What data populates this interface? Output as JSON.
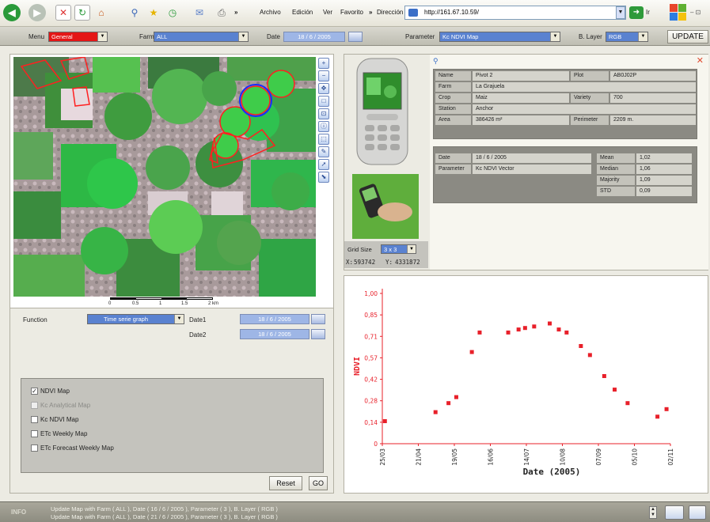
{
  "browser": {
    "menu": [
      "Archivo",
      "Edición",
      "Ver",
      "Favorito"
    ],
    "address_label": "Dirección",
    "url": "http://161.67.10.59/",
    "go_label": "Ir"
  },
  "header": {
    "menu_label": "Menu",
    "menu_value": "General",
    "farm_label": "Farm",
    "farm_value": "ALL",
    "date_label": "Date",
    "date_value": "18 / 6 / 2005",
    "parameter_label": "Parameter",
    "parameter_value": "Kc NDVI Map",
    "blayer_label": "B. Layer",
    "blayer_value": "RGB",
    "update_label": "UPDATE"
  },
  "map": {
    "scale_labels": [
      "0",
      "0.5",
      "1",
      "1.5",
      "2 km"
    ],
    "accent": "#ff2020",
    "highlight": "#1a2cff"
  },
  "function_panel": {
    "function_label": "Function",
    "function_value": "Time serie graph",
    "date1_label": "Date1",
    "date1_value": "18 / 6 / 2005",
    "date2_label": "Date2",
    "date2_value": "18 / 6 / 2005",
    "layers": [
      {
        "label": "NDVI Map",
        "checked": true,
        "enabled": true
      },
      {
        "label": "Kc Analytical Map",
        "checked": false,
        "enabled": false
      },
      {
        "label": "Kc NDVI Map",
        "checked": false,
        "enabled": true
      },
      {
        "label": "ETc Weekly Map",
        "checked": false,
        "enabled": true
      },
      {
        "label": "ETc Forecast Weekly Map",
        "checked": false,
        "enabled": true
      }
    ],
    "reset_label": "Reset",
    "go_label": "GO"
  },
  "device": {
    "grid_size_label": "Grid Size",
    "grid_size_value": "3 x 3",
    "x_label": "X:",
    "x_value": "593742",
    "y_label": "Y:",
    "y_value": "4331872"
  },
  "plot_info": {
    "name_label": "Name",
    "name_value": "Pivot 2",
    "plot_label": "Plot",
    "plot_value": "AB0J02P",
    "farm_label": "Farm",
    "farm_value": "La Grajuela",
    "crop_label": "Crop",
    "crop_value": "Maiz",
    "variety_label": "Variety",
    "variety_value": "700",
    "station_label": "Station",
    "station_value": "Anchor",
    "area_label": "Area",
    "area_value": "386426 m²",
    "perimeter_label": "Perimeter",
    "perimeter_value": "2209 m."
  },
  "stats": {
    "date_label": "Date",
    "date_value": "18 / 6 / 2005",
    "parameter_label": "Parameter",
    "parameter_value": "Kc NDVI Vector",
    "mean_label": "Mean",
    "mean_value": "1,02",
    "median_label": "Median",
    "median_value": "1,06",
    "majority_label": "Majority",
    "majority_value": "1,09",
    "std_label": "STD",
    "std_value": "0,09"
  },
  "chart_data": {
    "type": "scatter",
    "xlabel": "Date (2005)",
    "ylabel": "NDVI",
    "x_ticks": [
      "25/03",
      "21/04",
      "19/05",
      "16/06",
      "14/07",
      "10/08",
      "07/09",
      "05/10",
      "02/11"
    ],
    "y_ticks": [
      "0",
      "0,14",
      "0,28",
      "0,42",
      "0,57",
      "0,71",
      "0,85",
      "1,00"
    ],
    "ylim": [
      0,
      1
    ],
    "x_day_range": [
      84,
      306
    ],
    "marker_color": "#e8202a",
    "points": [
      {
        "day": 86,
        "ndvi": 0.15
      },
      {
        "day": 125,
        "ndvi": 0.21
      },
      {
        "day": 135,
        "ndvi": 0.27
      },
      {
        "day": 141,
        "ndvi": 0.31
      },
      {
        "day": 153,
        "ndvi": 0.61
      },
      {
        "day": 159,
        "ndvi": 0.74
      },
      {
        "day": 181,
        "ndvi": 0.74
      },
      {
        "day": 189,
        "ndvi": 0.76
      },
      {
        "day": 194,
        "ndvi": 0.77
      },
      {
        "day": 201,
        "ndvi": 0.78
      },
      {
        "day": 213,
        "ndvi": 0.8
      },
      {
        "day": 220,
        "ndvi": 0.76
      },
      {
        "day": 226,
        "ndvi": 0.74
      },
      {
        "day": 237,
        "ndvi": 0.65
      },
      {
        "day": 244,
        "ndvi": 0.59
      },
      {
        "day": 255,
        "ndvi": 0.45
      },
      {
        "day": 263,
        "ndvi": 0.36
      },
      {
        "day": 273,
        "ndvi": 0.27
      },
      {
        "day": 296,
        "ndvi": 0.18
      },
      {
        "day": 303,
        "ndvi": 0.23
      }
    ]
  },
  "status": {
    "label": "INFO",
    "lines": [
      "Update Map with Farm ( ALL ), Date ( 16 / 6 / 2005 ), Parameter ( 3 ), B. Layer ( RGB )",
      "Update Map with Farm ( ALL ), Date ( 21 / 6 / 2005 ), Parameter ( 3 ), B. Layer ( RGB )"
    ]
  }
}
